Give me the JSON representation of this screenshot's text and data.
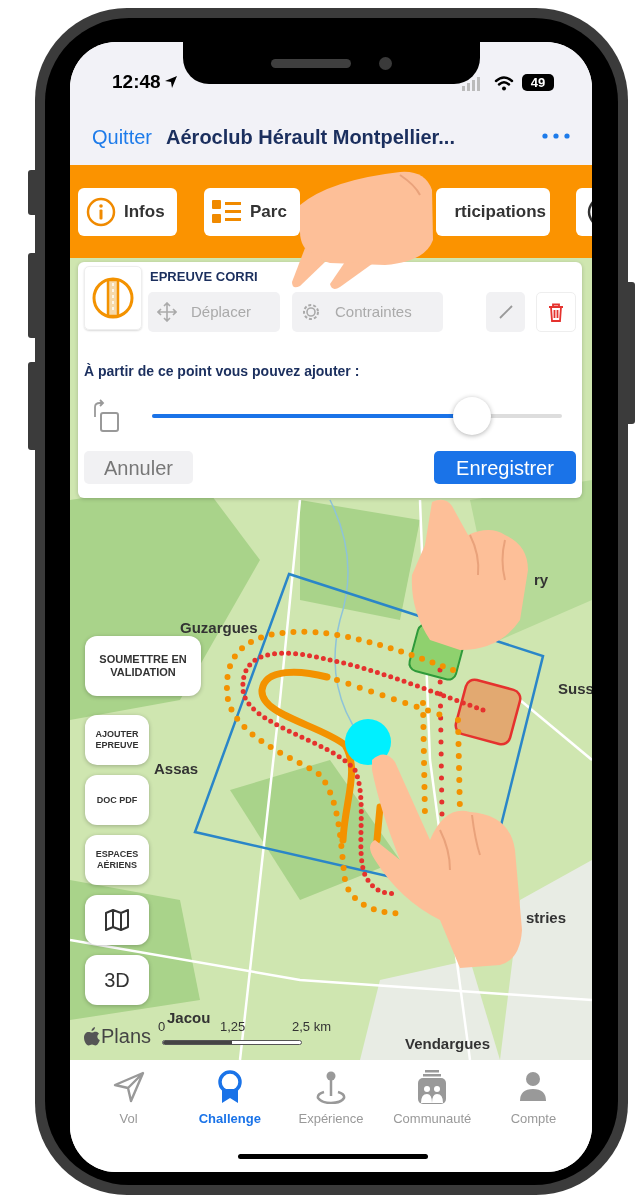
{
  "status_bar": {
    "time": "12:48",
    "battery": "49"
  },
  "nav": {
    "back": "Quitter",
    "title": "Aéroclub Hérault Montpellier..."
  },
  "section_tabs": [
    {
      "kind": "info",
      "label": "Infos"
    },
    {
      "kind": "list",
      "label": "Parc"
    },
    {
      "kind": "plain",
      "label": "rticipations"
    },
    {
      "kind": "signal"
    }
  ],
  "card": {
    "title": "EPREUVE CORRI",
    "actions": [
      {
        "kind": "move",
        "label": "Déplacer",
        "disabled": true
      },
      {
        "kind": "gear",
        "label": "Contraintes",
        "disabled": true
      }
    ],
    "prompt": "À partir de ce point vous pouvez ajouter :",
    "slider": {
      "level": 0.78
    },
    "cancel": "Annuler",
    "save": "Enregistrer"
  },
  "map": {
    "labels": [
      "ry",
      "Guzargues",
      "Suss",
      "Assas",
      "stries",
      "Jacou",
      "Vendargues"
    ],
    "side_buttons": [
      {
        "kind": "text",
        "label": "SOUMETTRE EN VALIDATION"
      },
      {
        "kind": "text",
        "label": "AJOUTER EPREUVE"
      },
      {
        "kind": "text",
        "label": "DOC PDF"
      },
      {
        "kind": "text",
        "label": "ESPACES AÉRIENS"
      },
      {
        "kind": "map"
      },
      {
        "kind": "text",
        "label": "3D"
      }
    ],
    "scale": [
      "0",
      "1,25",
      "2,5 km"
    ],
    "attribution": "Plans"
  },
  "tab_bar": [
    {
      "kind": "plane",
      "label": "Vol",
      "selected": false
    },
    {
      "kind": "ribbon",
      "label": "Challenge",
      "selected": true
    },
    {
      "kind": "pin",
      "label": "Expérience",
      "selected": false
    },
    {
      "kind": "people",
      "label": "Communauté",
      "selected": false
    },
    {
      "kind": "person",
      "label": "Compte",
      "selected": false
    }
  ]
}
